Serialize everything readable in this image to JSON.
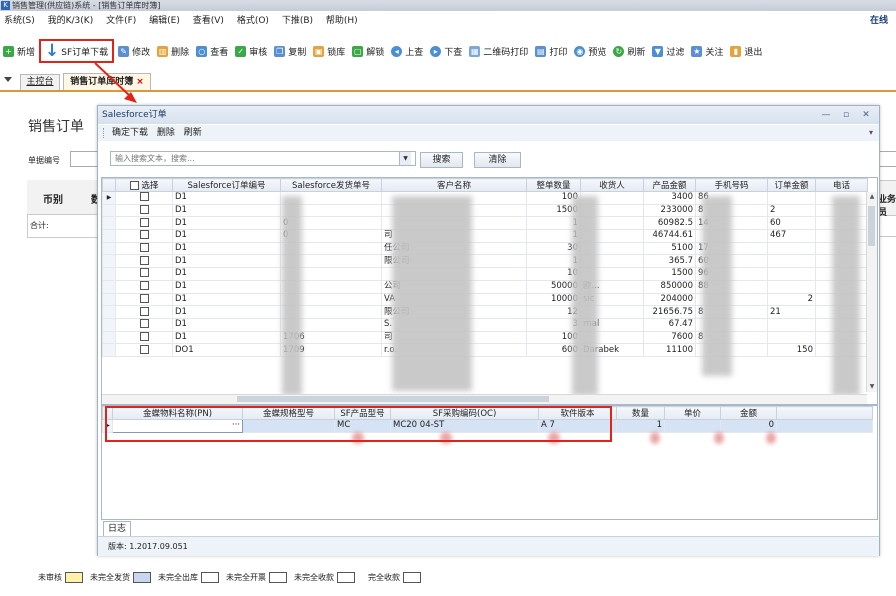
{
  "window": {
    "title": "销售管理(供应链)系统 - [销售订单库时簿]",
    "right_label": "在线"
  },
  "menu": [
    "系统(S)",
    "我的K/3(K)",
    "文件(F)",
    "编辑(E)",
    "查看(V)",
    "格式(O)",
    "下推(B)",
    "帮助(H)"
  ],
  "toolbar": {
    "new": "新增",
    "sf_download": "SF订单下载",
    "edit": "修改",
    "delete": "删除",
    "view": "查看",
    "audit": "审核",
    "copy": "复制",
    "lock": "锁库",
    "unlock": "解锁",
    "up": "上查",
    "down": "下查",
    "qr_print": "二维码打印",
    "print": "打印",
    "preview": "预览",
    "refresh": "刷新",
    "filter": "过滤",
    "follow": "关注",
    "exit": "退出"
  },
  "tabs": {
    "main": "主控台",
    "current": "销售订单库时簿"
  },
  "background": {
    "title": "销售订单",
    "field": "单据编号",
    "col_currency": "币别",
    "total": "合计:",
    "right_col": "业务员"
  },
  "dialog": {
    "title": "Salesforce订单",
    "menu": [
      "确定下载",
      "删除",
      "刷新"
    ],
    "search_placeholder": "输入搜索文本，搜索...",
    "search_button": "搜索",
    "clear_button": "清除",
    "columns": [
      "选择",
      "Salesforce订单编号",
      "Salesforce发货单号",
      "客户名称",
      "整单数量",
      "收货人",
      "产品金额",
      "手机号码",
      "订单金额",
      "电话"
    ],
    "rows": [
      [
        "D1",
        "",
        "",
        "",
        "100",
        "",
        "3400",
        "86",
        "",
        ""
      ],
      [
        "D1",
        "095",
        "",
        "",
        "1500",
        "",
        "233000",
        "8",
        "",
        "2"
      ],
      [
        "D1",
        "08",
        "0",
        "",
        "1",
        "",
        "60982.5",
        "",
        "14",
        "60"
      ],
      [
        "D1",
        "09",
        "0",
        "",
        "1",
        "",
        "46744.61",
        "",
        "",
        "467"
      ],
      [
        "D1",
        "08",
        "",
        "",
        "30",
        "",
        "5100",
        "",
        "17",
        ""
      ],
      [
        "D1",
        "09",
        "",
        "",
        "1",
        "",
        "365.7",
        "",
        "60",
        ""
      ],
      [
        "D1",
        "03",
        "",
        "",
        "10",
        "",
        "1500",
        "",
        "96",
        ""
      ],
      [
        "D1",
        "05",
        "",
        "",
        "50000",
        "",
        "850000",
        "",
        "88",
        ""
      ],
      [
        "D1",
        "70",
        "",
        "",
        "10000",
        "",
        "204000",
        "",
        "",
        "2"
      ],
      [
        "D1",
        "60",
        "",
        "",
        "12",
        "",
        "21656.75",
        "8",
        "",
        "21"
      ],
      [
        "D1",
        "80",
        "",
        "",
        "3",
        "",
        "67.47",
        "",
        "",
        ""
      ],
      [
        "D1",
        "01",
        "1706",
        "",
        "100",
        "",
        "7600",
        "8",
        "",
        ""
      ],
      [
        "DO1",
        "",
        "1709",
        "",
        "600",
        "",
        "11100",
        "",
        "",
        "150"
      ]
    ],
    "partial_names": {
      "r3": "司",
      "r4": "任公司",
      "r5": "限公司",
      "r7": "公司",
      "r8": "VA",
      "r9": "限公司",
      "r10": "S.",
      "r11": "司",
      "r12": "r.o."
    },
    "receiver_partial": {
      "r7": "欧...",
      "r8": "sic",
      "r10": "rnal",
      "r12": "Darabek"
    },
    "detail_columns": [
      "金蝶物料名称(PN)",
      "金蝶规格型号",
      "SF产品型号",
      "SF采购编码(OC)",
      "软件版本",
      "数量",
      "单价",
      "金额"
    ],
    "detail_row": {
      "pn": "",
      "spec": "",
      "sf_model": "MC",
      "sf_oc": "MC20 04-ST",
      "software": "A 7",
      "qty": "1",
      "price": "",
      "amount": "0"
    },
    "log_tab": "日志",
    "version": "版本: 1.2017.09.051"
  },
  "legend": [
    {
      "label": "未审核",
      "color": "#fff2a8"
    },
    {
      "label": "未完全发货",
      "color": "#c9d7ee"
    },
    {
      "label": "未完全出库",
      "color": "#ffffff"
    },
    {
      "label": "未完全开票",
      "color": "#ffffff"
    },
    {
      "label": "未完全收款",
      "color": "#ffffff"
    },
    {
      "label": "完全收款",
      "color": "#ffffff"
    }
  ]
}
